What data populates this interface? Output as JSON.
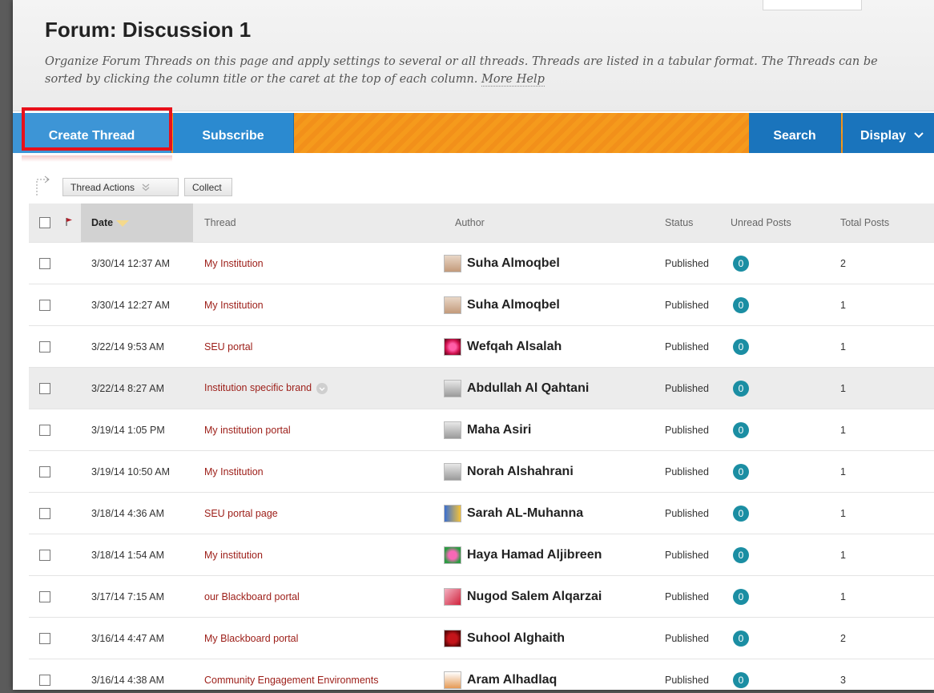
{
  "header": {
    "title": "Forum: Discussion 1",
    "description": "Organize Forum Threads on this page and apply settings to several or all threads. Threads are listed in a tabular format. The Threads can be sorted by clicking the column title or the caret at the top of each column.",
    "more_help": "More Help"
  },
  "action_bar": {
    "create_thread": "Create Thread",
    "subscribe": "Subscribe",
    "search": "Search",
    "display": "Display"
  },
  "toolbar": {
    "thread_actions": "Thread Actions",
    "collect": "Collect"
  },
  "table": {
    "columns": {
      "date": "Date",
      "thread": "Thread",
      "author": "Author",
      "status": "Status",
      "unread": "Unread Posts",
      "total": "Total Posts"
    },
    "rows": [
      {
        "date": "3/30/14 12:37 AM",
        "thread": "My Institution",
        "author": "Suha Almoqbel",
        "status": "Published",
        "unread": "0",
        "total": "2"
      },
      {
        "date": "3/30/14 12:27 AM",
        "thread": "My Institution",
        "author": "Suha Almoqbel",
        "status": "Published",
        "unread": "0",
        "total": "1"
      },
      {
        "date": "3/22/14 9:53 AM",
        "thread": "SEU portal",
        "author": "Wefqah Alsalah",
        "status": "Published",
        "unread": "0",
        "total": "1"
      },
      {
        "date": "3/22/14 8:27 AM",
        "thread": "Institution specific brand",
        "author": "Abdullah Al Qahtani",
        "status": "Published",
        "unread": "0",
        "total": "1"
      },
      {
        "date": "3/19/14 1:05 PM",
        "thread": "My institution portal",
        "author": "Maha Asiri",
        "status": "Published",
        "unread": "0",
        "total": "1"
      },
      {
        "date": "3/19/14 10:50 AM",
        "thread": "My Institution",
        "author": "Norah Alshahrani",
        "status": "Published",
        "unread": "0",
        "total": "1"
      },
      {
        "date": "3/18/14 4:36 AM",
        "thread": "SEU portal page",
        "author": "Sarah AL-Muhanna",
        "status": "Published",
        "unread": "0",
        "total": "1"
      },
      {
        "date": "3/18/14 1:54 AM",
        "thread": "My institution",
        "author": "Haya Hamad Aljibreen",
        "status": "Published",
        "unread": "0",
        "total": "1"
      },
      {
        "date": "3/17/14 7:15 AM",
        "thread": "our Blackboard portal",
        "author": "Nugod Salem Alqarzai",
        "status": "Published",
        "unread": "0",
        "total": "1"
      },
      {
        "date": "3/16/14 4:47 AM",
        "thread": "My Blackboard portal",
        "author": "Suhool Alghaith",
        "status": "Published",
        "unread": "0",
        "total": "2"
      },
      {
        "date": "3/16/14 4:38 AM",
        "thread": "Community Engagement Environments",
        "author": "Aram Alhadlaq",
        "status": "Published",
        "unread": "0",
        "total": "3"
      }
    ]
  },
  "colors": {
    "accent_orange": "#f59a1c",
    "button_blue": "#2b8ad0",
    "highlight_red": "#e8101a",
    "thread_link": "#9c1d17",
    "unread_badge": "#1b8ea3"
  },
  "icons": {
    "flag": "flag-icon",
    "sort": "caret-down-icon",
    "avatars": [
      "avatar-photo-icon",
      "avatar-photo-icon",
      "avatar-flower-icon",
      "avatar-default-icon",
      "avatar-default-icon",
      "avatar-default-icon",
      "avatar-cartoon-icon",
      "avatar-rose-icon",
      "avatar-heart-icon",
      "avatar-rose-dark-icon",
      "avatar-doc-icon"
    ]
  }
}
